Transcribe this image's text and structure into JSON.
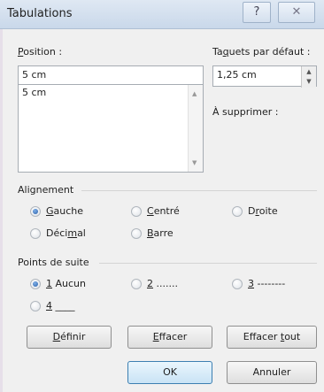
{
  "dialog": {
    "title": "Tabulations",
    "help_icon": "?",
    "close_icon": "✕"
  },
  "position": {
    "label_pre": "",
    "label_acc": "P",
    "label_post": "osition :",
    "value": "5 cm",
    "list_items": [
      "5 cm"
    ]
  },
  "default_tabs": {
    "label_pre": "Ta",
    "label_acc": "q",
    "label_post": "uets par défaut :",
    "value": "1,25 cm"
  },
  "to_clear": {
    "label": "À supprimer :"
  },
  "alignment": {
    "title": "Alignement",
    "options": [
      {
        "pre": "",
        "acc": "G",
        "post": "auche",
        "checked": true
      },
      {
        "pre": "",
        "acc": "C",
        "post": "entré",
        "checked": false
      },
      {
        "pre": "D",
        "acc": "r",
        "post": "oite",
        "checked": false
      },
      {
        "pre": "Déci",
        "acc": "m",
        "post": "al",
        "checked": false
      },
      {
        "pre": "",
        "acc": "B",
        "post": "arre",
        "checked": false
      }
    ]
  },
  "leader": {
    "title": "Points de suite",
    "options": [
      {
        "acc": "1",
        "post": " Aucun",
        "checked": true
      },
      {
        "acc": "2",
        "post": " .......",
        "checked": false
      },
      {
        "acc": "3",
        "post": " --------",
        "checked": false
      },
      {
        "acc": "4",
        "post": " ____",
        "checked": false
      }
    ]
  },
  "buttons": {
    "set": {
      "pre": "",
      "acc": "D",
      "post": "éfinir"
    },
    "clear": {
      "pre": "",
      "acc": "E",
      "post": "ffacer"
    },
    "clear_all": {
      "pre": "Effacer ",
      "acc": "t",
      "post": "out"
    },
    "ok": "OK",
    "cancel": "Annuler"
  }
}
